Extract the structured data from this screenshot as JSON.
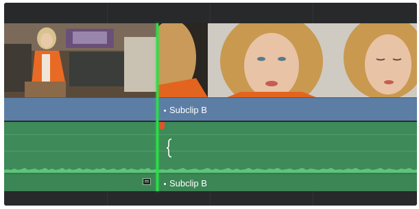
{
  "timeline": {
    "video_track": {
      "clips": [
        {
          "label": "",
          "thumb_icon": "woman-orange-jacket-thumbnail"
        },
        {
          "label": "Subclip B",
          "thumb_icon": "woman-closeup-thumbnail"
        }
      ]
    },
    "audio_track": {
      "clips": [
        {
          "label": ""
        },
        {
          "label": "Subclip B"
        }
      ]
    },
    "colors": {
      "video_clip": "#5f7fa3",
      "audio_clip": "#3e8a58",
      "playhead": "#29e046",
      "marker": "#e0542a"
    }
  }
}
